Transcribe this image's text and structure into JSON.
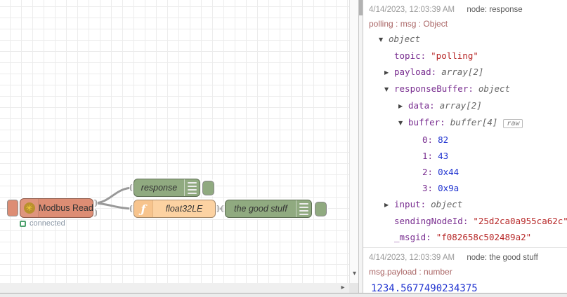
{
  "canvas": {
    "nodes": {
      "modbus": {
        "label": "Modbus Read",
        "status": "connected",
        "icon": "✳"
      },
      "response": {
        "label": "response"
      },
      "float32": {
        "label": "float32LE",
        "icon": "ƒ"
      },
      "goodstuff": {
        "label": "the good stuff"
      }
    },
    "colors": {
      "modbus": "#dd8d74",
      "debug": "#90aa80",
      "function": "#fcd2a2",
      "wire": "#999999",
      "status": "#4ca06c"
    },
    "scroll": {
      "down_arrow": "▾",
      "right_arrow": "▸"
    }
  },
  "sidebar": {
    "messages": [
      {
        "timestamp": "4/14/2023, 12:03:39 AM",
        "node_label": "node: response",
        "meta": "polling : msg : Object",
        "raw_label": "raw",
        "tree": [
          {
            "caret": "▼",
            "key": "",
            "value": "object",
            "type": "meta",
            "indent": 0
          },
          {
            "caret": "",
            "key": "topic:",
            "value": "\"polling\"",
            "type": "string",
            "indent": 1
          },
          {
            "caret": "▶",
            "key": "payload:",
            "value": "array[2]",
            "type": "meta",
            "indent": 1
          },
          {
            "caret": "▼",
            "key": "responseBuffer:",
            "value": "object",
            "type": "meta",
            "indent": 1
          },
          {
            "caret": "▶",
            "key": "data:",
            "value": "array[2]",
            "type": "meta",
            "indent": 2
          },
          {
            "caret": "▼",
            "key": "buffer:",
            "value": "buffer[4]",
            "type": "meta",
            "indent": 2,
            "badge": "raw"
          },
          {
            "caret": "",
            "key": "0:",
            "value": "82",
            "type": "number",
            "indent": 3
          },
          {
            "caret": "",
            "key": "1:",
            "value": "43",
            "type": "number",
            "indent": 3
          },
          {
            "caret": "",
            "key": "2:",
            "value": "0x44",
            "type": "number",
            "indent": 3
          },
          {
            "caret": "",
            "key": "3:",
            "value": "0x9a",
            "type": "number",
            "indent": 3
          },
          {
            "caret": "▶",
            "key": "input:",
            "value": "object",
            "type": "meta",
            "indent": 1
          },
          {
            "caret": "",
            "key": "sendingNodeId:",
            "value": "\"25d2ca0a955ca62c\"",
            "type": "string",
            "indent": 1
          },
          {
            "caret": "",
            "key": "_msgid:",
            "value": "\"f082658c502489a2\"",
            "type": "string",
            "indent": 1
          }
        ]
      },
      {
        "timestamp": "4/14/2023, 12:03:39 AM",
        "node_label": "node: the good stuff",
        "meta": "msg.payload : number",
        "value": "1234.5677490234375"
      }
    ]
  }
}
